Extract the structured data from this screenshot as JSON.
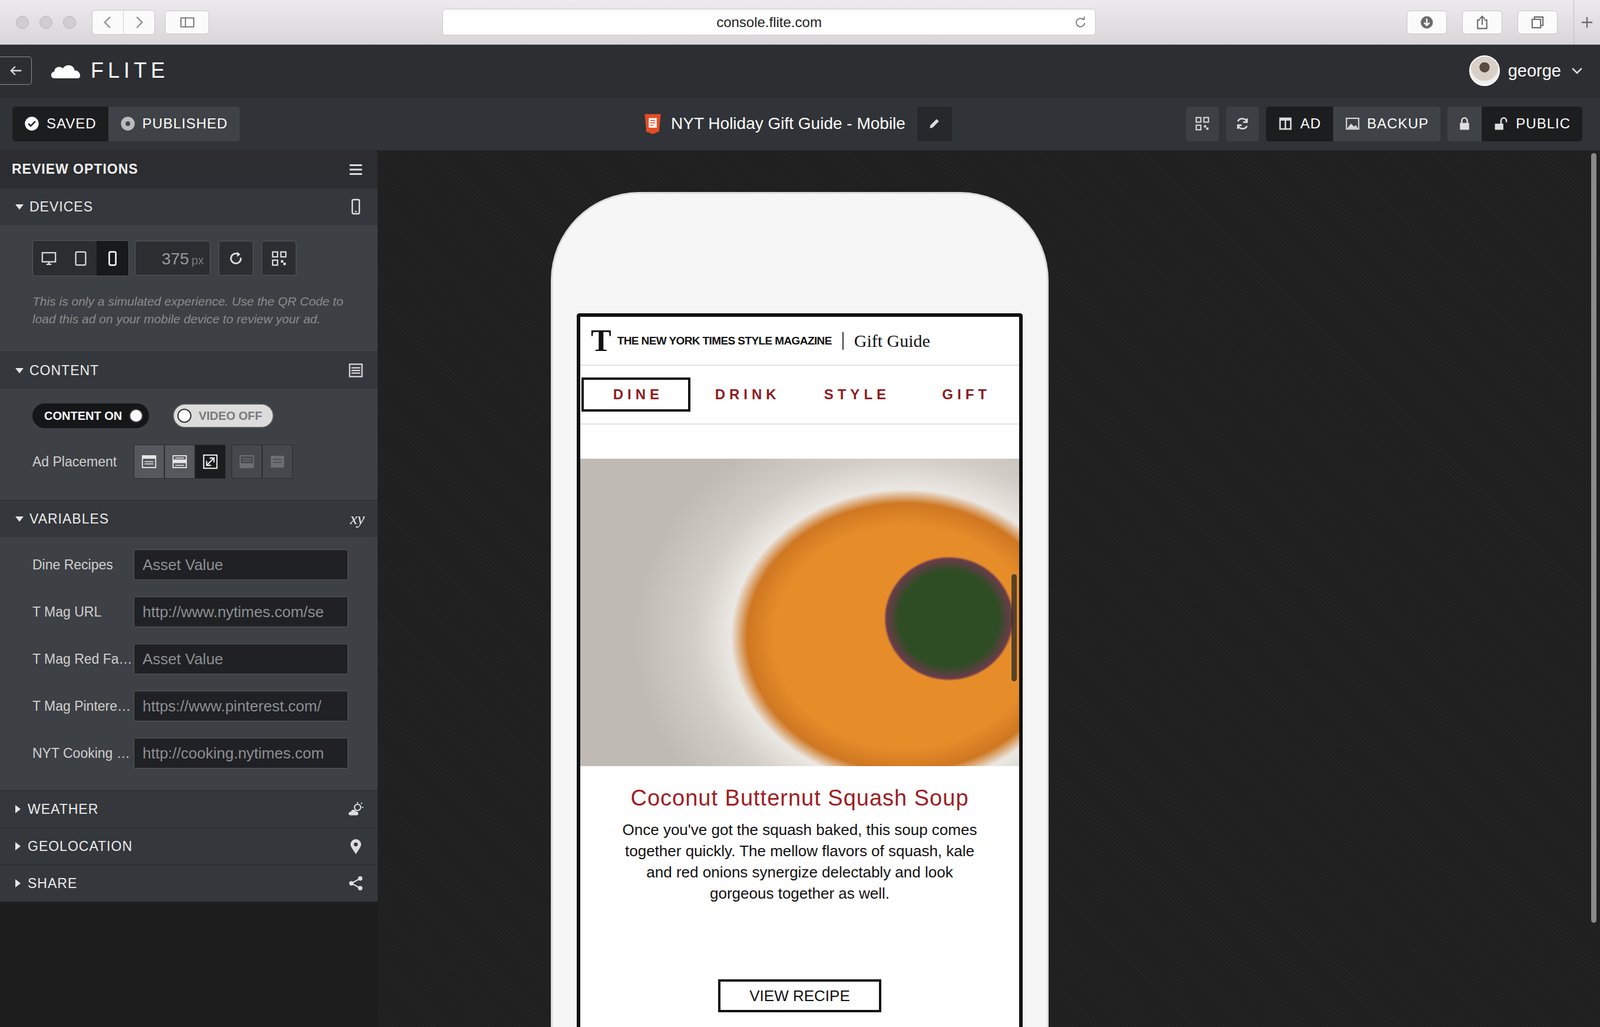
{
  "browser": {
    "url": "console.flite.com"
  },
  "header": {
    "logo": "FLITE",
    "user": "george"
  },
  "toolbar": {
    "status": [
      {
        "label": "SAVED",
        "selected": true
      },
      {
        "label": "PUBLISHED",
        "selected": false
      }
    ],
    "title": "NYT Holiday Gift Guide - Mobile",
    "views": [
      {
        "label": "AD",
        "selected": true
      },
      {
        "label": "BACKUP",
        "selected": false
      }
    ],
    "access": [
      {
        "kind": "lock",
        "selected": false
      },
      {
        "kind": "public",
        "label": "PUBLIC",
        "selected": true
      }
    ]
  },
  "panel": {
    "title": "REVIEW OPTIONS",
    "sections": [
      {
        "kind": "devices",
        "title": "DEVICES",
        "expanded": true
      },
      {
        "kind": "content",
        "title": "CONTENT",
        "expanded": true
      },
      {
        "kind": "variables",
        "title": "VARIABLES",
        "expanded": true,
        "icon_text": "xy"
      },
      {
        "kind": "weather",
        "title": "WEATHER",
        "expanded": false
      },
      {
        "kind": "geolocation",
        "title": "GEOLOCATION",
        "expanded": false
      },
      {
        "kind": "share",
        "title": "SHARE",
        "expanded": false
      }
    ]
  },
  "devices": {
    "options": [
      {
        "kind": "desktop",
        "selected": false
      },
      {
        "kind": "tablet",
        "selected": false
      },
      {
        "kind": "phone",
        "selected": true
      }
    ],
    "width": "375",
    "unit": "px",
    "note": "This is only a simulated experience. Use the QR Code to load this ad on your mobile device to review your ad."
  },
  "content": {
    "toggles": [
      {
        "label": "CONTENT ON",
        "on": true
      },
      {
        "label": "VIDEO OFF",
        "on": false
      }
    ],
    "placement_label": "Ad Placement",
    "placements": [
      {
        "kind": "top",
        "selected": false,
        "disabled": false
      },
      {
        "kind": "middle",
        "selected": false,
        "disabled": false
      },
      {
        "kind": "expand",
        "selected": true,
        "disabled": false
      },
      {
        "kind": "bottom",
        "selected": false,
        "disabled": true
      },
      {
        "kind": "full",
        "selected": false,
        "disabled": true
      }
    ]
  },
  "variables": [
    {
      "label": "Dine Recipes",
      "value": "Asset Value"
    },
    {
      "label": "T Mag URL",
      "value": "http://www.nytimes.com/se"
    },
    {
      "label": "T Mag Red Fa…",
      "value": "Asset Value"
    },
    {
      "label": "T Mag Pintere…",
      "value": "https://www.pinterest.com/"
    },
    {
      "label": "NYT Cooking …",
      "value": "http://cooking.nytimes.com"
    }
  ],
  "preview": {
    "logo": "T",
    "brand": "THE NEW YORK TIMES STYLE MAGAZINE",
    "section": "Gift Guide",
    "nav": [
      {
        "label": "DINE",
        "selected": true
      },
      {
        "label": "DRINK",
        "selected": false
      },
      {
        "label": "STYLE",
        "selected": false
      },
      {
        "label": "GIFT",
        "selected": false
      }
    ],
    "recipe": {
      "title": "Coconut Butternut Squash Soup",
      "body": "Once you've got the squash baked, this soup comes together quickly. The mellow flavors of squash, kale and red onions synergize delectably and look gorgeous together as well.",
      "button": "VIEW RECIPE"
    }
  }
}
